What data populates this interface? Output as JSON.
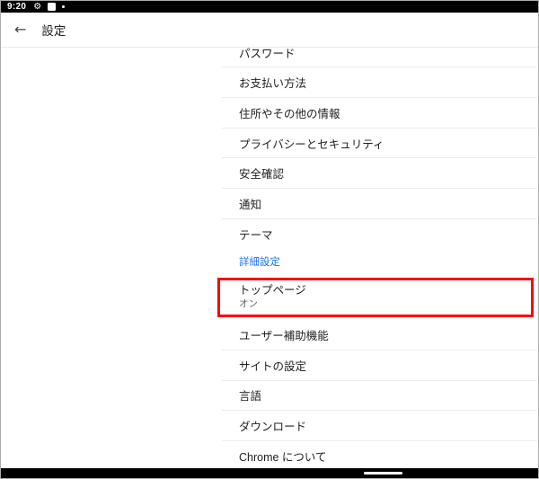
{
  "status_bar": {
    "time": "9:20",
    "gear_glyph": "⚙",
    "icons": [
      "gear-icon",
      "app-notification-square-icon",
      "notification-dot-icon"
    ]
  },
  "header": {
    "back_glyph": "←",
    "title": "設定"
  },
  "list": {
    "items": [
      {
        "label": "パスワード"
      },
      {
        "label": "お支払い方法"
      },
      {
        "label": "住所やその他の情報"
      },
      {
        "label": "プライバシーとセキュリティ"
      },
      {
        "label": "安全確認"
      },
      {
        "label": "通知"
      },
      {
        "label": "テーマ"
      }
    ],
    "advanced_label": "詳細設定",
    "highlighted": {
      "label": "トップページ",
      "status": "オン"
    },
    "items2": [
      {
        "label": "ユーザー補助機能"
      },
      {
        "label": "サイトの設定"
      },
      {
        "label": "言語"
      },
      {
        "label": "ダウンロード"
      },
      {
        "label": "Chrome について"
      }
    ]
  },
  "colors": {
    "highlight_red": "#fb0007",
    "accent_blue": "#1a73e8",
    "divider": "#ebebeb",
    "text_primary": "#202124",
    "text_secondary": "#5f6368"
  }
}
